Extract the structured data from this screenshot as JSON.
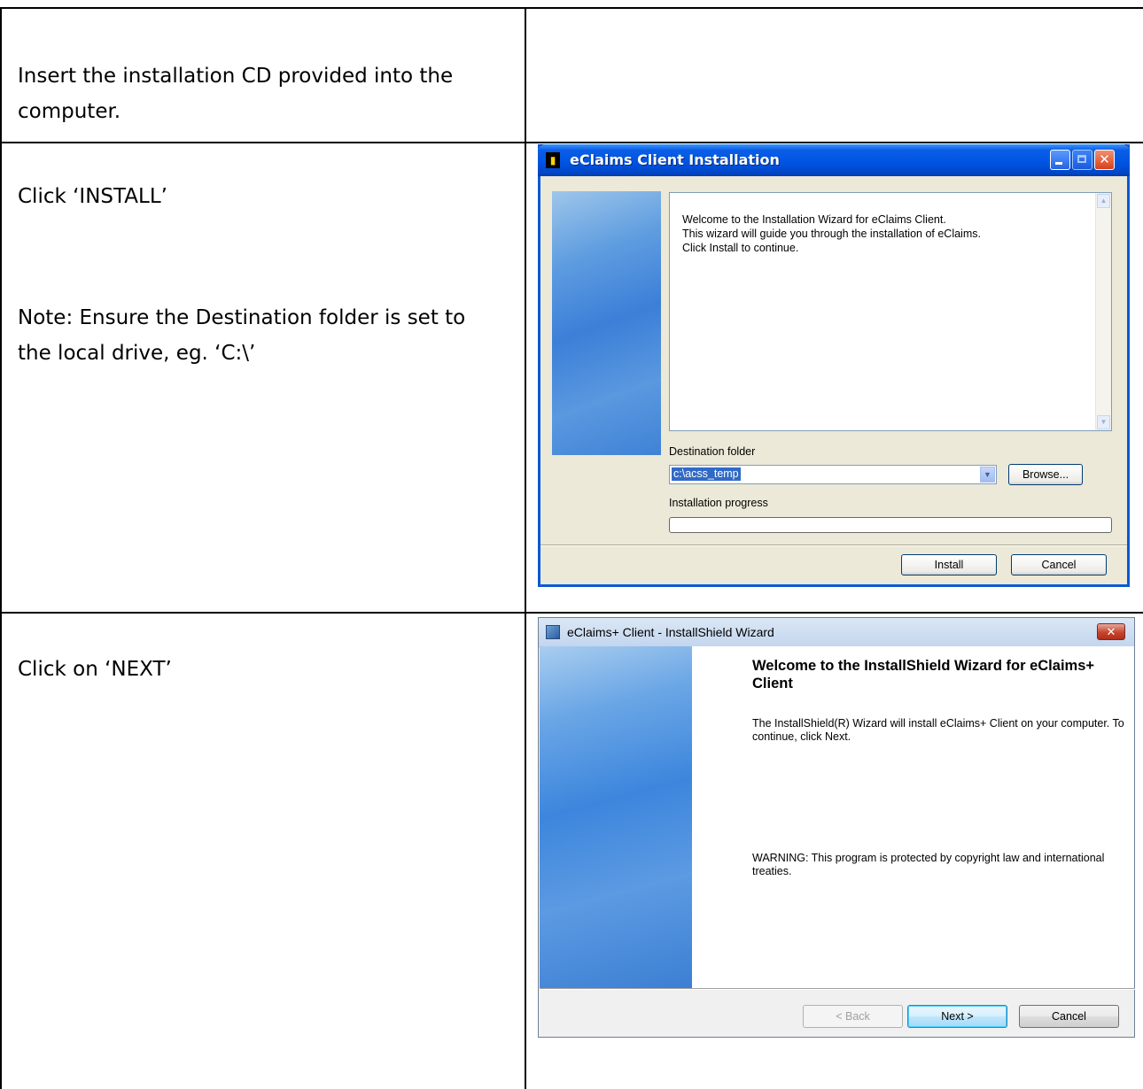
{
  "steps": [
    {
      "text": "Insert the installation CD provided into the computer."
    },
    {
      "text": "Click ‘INSTALL’",
      "note": "Note: Ensure the Destination folder is set to the local drive, eg. ‘C:\\’"
    },
    {
      "text": "Click on ‘NEXT’"
    }
  ],
  "xp_dialog": {
    "title": "eClaims Client Installation",
    "title_icon": "installer-icon",
    "welcome_lines": [
      "Welcome to the Installation Wizard for eClaims Client.",
      "This wizard will guide you through the installation of eClaims.",
      "Click Install to continue."
    ],
    "destination_label": "Destination folder",
    "destination_value": "c:\\acss_temp",
    "browse_label": "Browse...",
    "progress_label": "Installation progress",
    "progress": 0,
    "install_label": "Install",
    "cancel_label": "Cancel",
    "titlebar_color": "#0054e3"
  },
  "vista_dialog": {
    "title": "eClaims+ Client - InstallShield Wizard",
    "title_icon": "installshield-icon",
    "heading": "Welcome to the InstallShield Wizard for eClaims+ Client",
    "intro": "The InstallShield(R) Wizard will install eClaims+ Client on your computer. To continue, click Next.",
    "warning": "WARNING: This program is protected by copyright law and international treaties.",
    "back_label": "< Back",
    "next_label": "Next >",
    "cancel_label": "Cancel"
  }
}
